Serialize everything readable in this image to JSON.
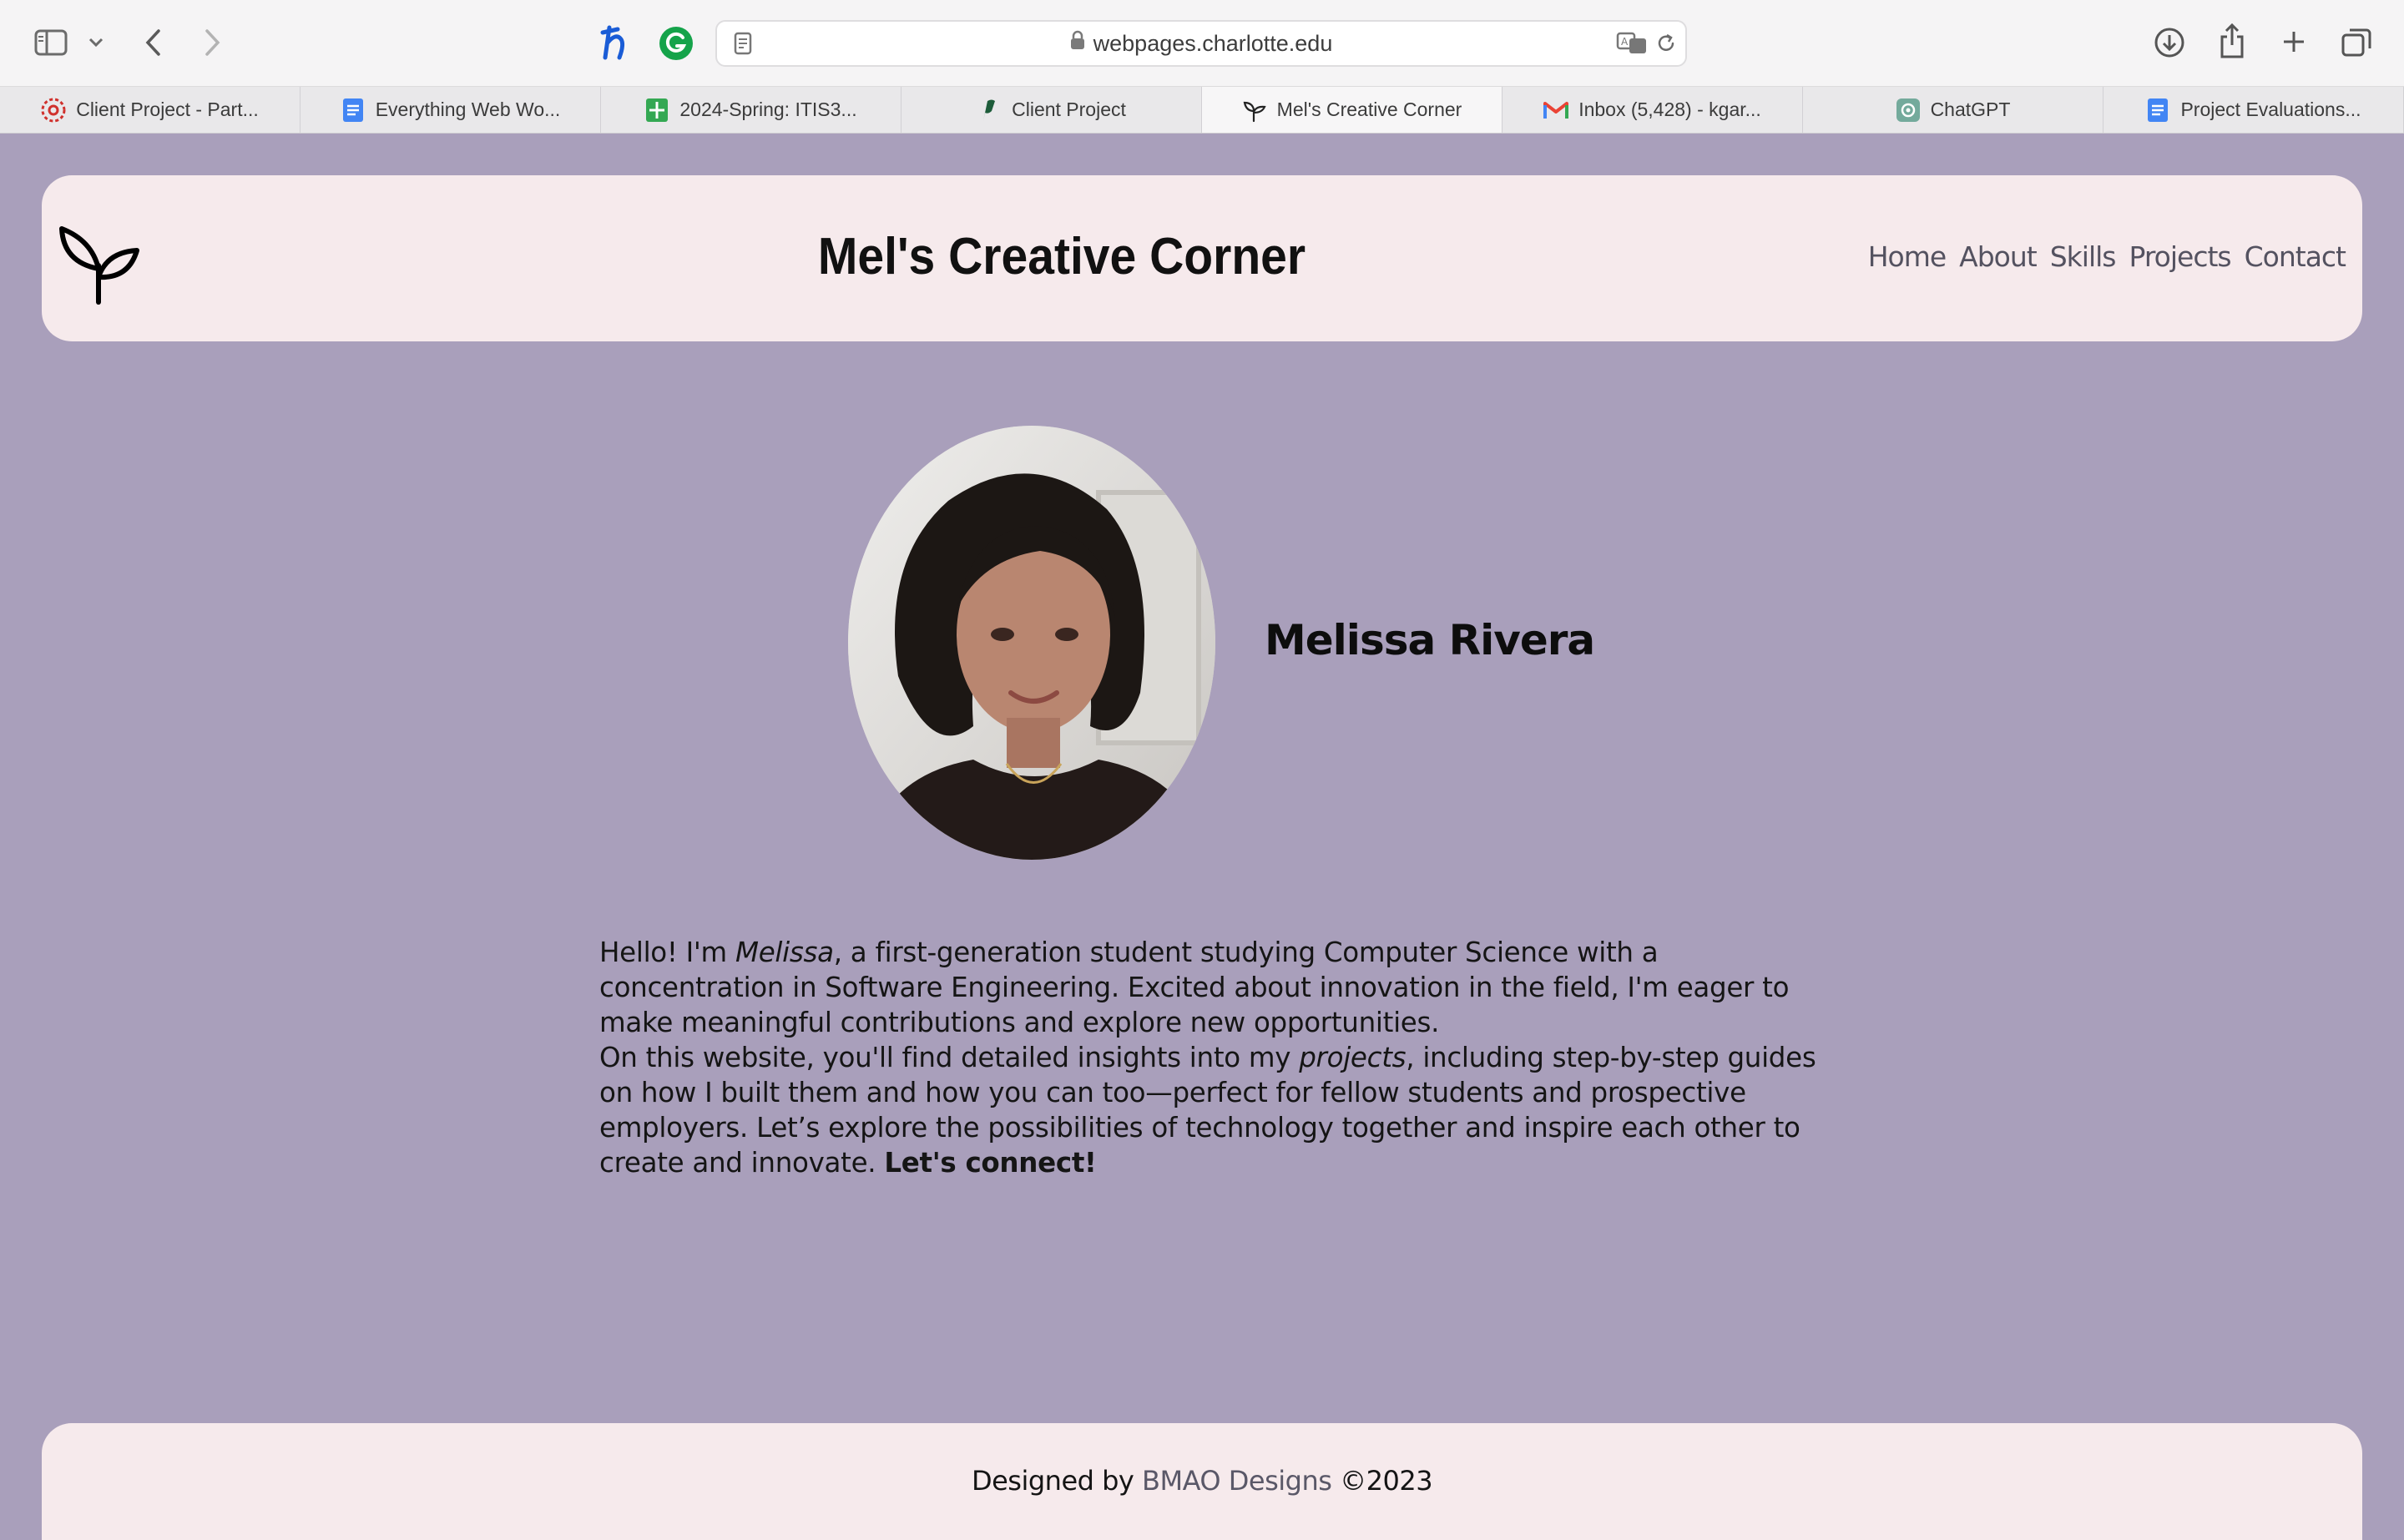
{
  "browser": {
    "url": "webpages.charlotte.edu",
    "tabs": [
      {
        "title": "Client Project - Part...",
        "icon": "canvas-lms-icon"
      },
      {
        "title": "Everything Web Wo...",
        "icon": "google-docs-icon"
      },
      {
        "title": "2024-Spring: ITIS3...",
        "icon": "google-sheets-icon"
      },
      {
        "title": "Client Project",
        "icon": "notion-icon"
      },
      {
        "title": "Mel's Creative Corner",
        "icon": "sprout-icon",
        "active": true
      },
      {
        "title": "Inbox (5,428) - kgar...",
        "icon": "gmail-icon"
      },
      {
        "title": "ChatGPT",
        "icon": "chatgpt-icon"
      },
      {
        "title": "Project Evaluations...",
        "icon": "google-docs-icon"
      }
    ]
  },
  "header": {
    "title": "Mel's Creative Corner",
    "nav": [
      "Home",
      "About",
      "Skills",
      "Projects",
      "Contact"
    ]
  },
  "profile": {
    "name": "Melissa Rivera",
    "bio": {
      "p1_a": "Hello! I'm ",
      "p1_em": "Melissa",
      "p1_b": ", a first-generation student studying Computer Science with a concentration in Software Engineering. Excited about innovation in the field, I'm eager to make meaningful contributions and explore new opportunities.",
      "p2_a": "On this website, you'll find detailed insights into my ",
      "p2_em": "projects",
      "p2_b": ", including step-by-step guides on how I built them and how you can too—perfect for fellow students and prospective employers. Let’s explore the possibilities of technology together and inspire each other to create and innovate. ",
      "p2_strong": "Let's connect!"
    }
  },
  "footer": {
    "prefix": "Designed by ",
    "link": "BMAO Designs",
    "suffix": " ©2023"
  },
  "colors": {
    "page_bg": "#a99fbb",
    "card_bg": "#f6eaec",
    "nav_text": "#545260"
  }
}
